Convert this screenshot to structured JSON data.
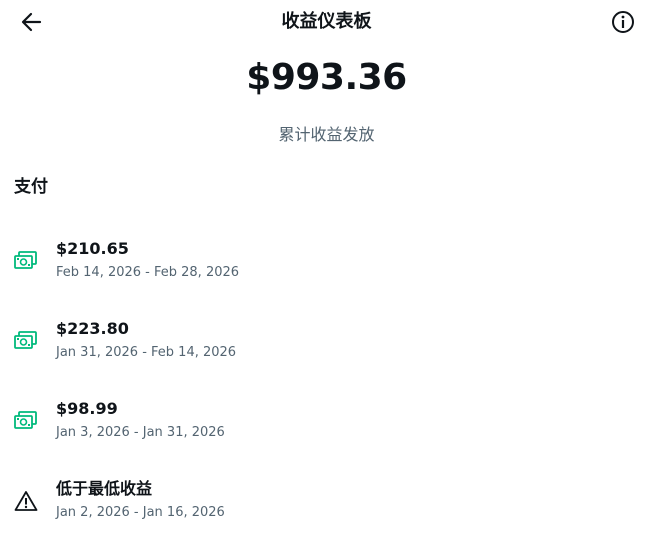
{
  "header": {
    "title": "收益仪表板"
  },
  "summary": {
    "amount": "$993.36",
    "caption": "累计收益发放"
  },
  "section": {
    "title": "支付"
  },
  "payouts": [
    {
      "title": "$210.65",
      "dates": "Feb 14, 2026 - Feb 28, 2026",
      "icon": "money-icon"
    },
    {
      "title": "$223.80",
      "dates": "Jan 31, 2026 - Feb 14, 2026",
      "icon": "money-icon"
    },
    {
      "title": "$98.99",
      "dates": "Jan 3, 2026 - Jan 31, 2026",
      "icon": "money-icon"
    },
    {
      "title": "低于最低收益",
      "dates": "Jan 2, 2026 - Jan 16, 2026",
      "icon": "warning-icon"
    }
  ],
  "colors": {
    "money_icon": "#00ba7c",
    "muted_text": "#536471",
    "primary_text": "#0f1419"
  }
}
